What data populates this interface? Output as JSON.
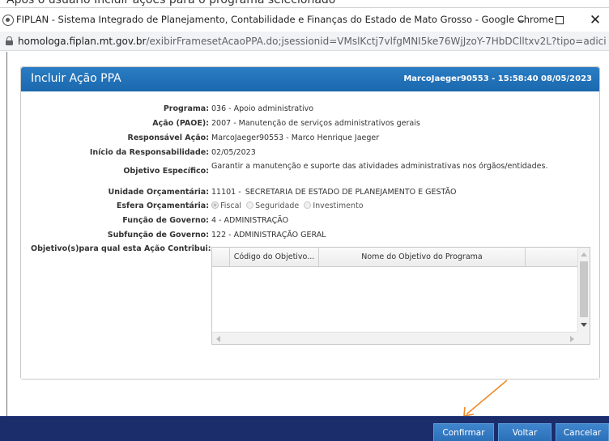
{
  "caption": "Após o usuário Incluir ações para o programa selecionado",
  "window": {
    "title": "FIPLAN - Sistema Integrado de Planejamento, Contabilidade e Finanças do Estado de Mato Grosso - Google Chrome",
    "minimize": "–",
    "close": "✕"
  },
  "address": {
    "host": "homologa.fiplan.mt.gov.br",
    "path": "/exibirFramesetAcaoPPA.do;jsessionid=VMslKctj7vlfgMNI5ke76WjJzoY-7HbDClltxv2L?tipo=adicionar&iden..."
  },
  "dialog": {
    "title": "Incluir Ação PPA",
    "user_stamp": "MarcoJaeger90553 - 15:58:40 08/05/2023"
  },
  "form": {
    "programa": {
      "label": "Programa:",
      "value": "036 - Apoio administrativo"
    },
    "acao": {
      "label": "Ação (PAOE):",
      "value": "2007 - Manutenção de serviços administrativos gerais"
    },
    "responsavel": {
      "label": "Responsável Ação:",
      "value": "MarcoJaeger90553 - Marco Henrique Jaeger"
    },
    "inicio": {
      "label": "Início da Responsabilidade:",
      "value": "02/05/2023"
    },
    "objetivo_especifico": {
      "label": "Objetivo Específico:",
      "value": "Garantir a manutenção e suporte das atividades administrativas nos órgãos/entidades."
    },
    "unidade": {
      "label": "Unidade Orçamentária:",
      "code": "11101",
      "dash": "-",
      "name": "SECRETARIA DE ESTADO DE PLANEJAMENTO E GESTÃO"
    },
    "esfera": {
      "label": "Esfera Orçamentária:",
      "options": [
        "Fiscal",
        "Seguridade",
        "Investimento"
      ],
      "selected": "Fiscal"
    },
    "funcao": {
      "label": "Função de Governo:",
      "value": "4 - ADMINISTRAÇÃO"
    },
    "subfuncao": {
      "label": "Subfunção de Governo:",
      "value": "122 - ADMINISTRAÇÃO GERAL"
    },
    "objetivos_label": "Objetivo(s)para qual esta Ação Contribui:"
  },
  "grid": {
    "columns": [
      "",
      "Código do Objetivo...",
      "Nome do Objetivo do Programa",
      ""
    ]
  },
  "footer": {
    "confirmar": "Confirmar",
    "voltar": "Voltar",
    "cancelar": "Cancelar"
  },
  "colors": {
    "header_blue": "#1e6fb8",
    "footer_navy": "#1c2d6b",
    "arrow_orange": "#f08a2b"
  }
}
